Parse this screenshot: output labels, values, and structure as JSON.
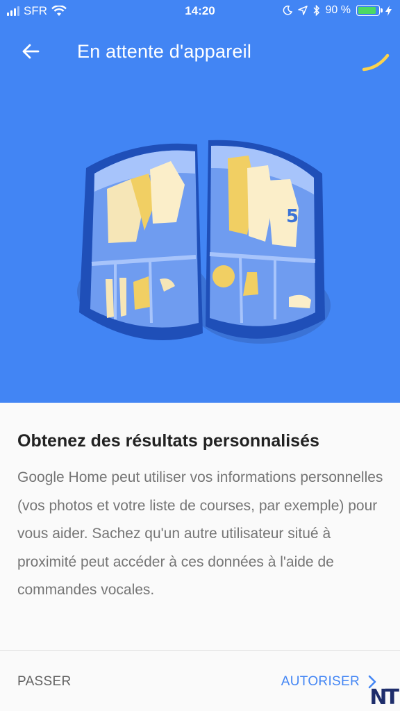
{
  "status_bar": {
    "carrier": "SFR",
    "time": "14:20",
    "battery": "90 %",
    "battery_level": 0.9
  },
  "app_bar": {
    "title": "En attente d'appareil"
  },
  "content": {
    "heading": "Obtenez des résultats personnalisés",
    "body": "Google Home peut utiliser vos informations personnelles (vos photos et votre liste de courses, par exemple) pour vous aider. Sachez qu'un autre utilisateur situé à proximité peut accéder à ces données à l'aide de commandes vocales."
  },
  "actions": {
    "skip_label": "PASSER",
    "allow_label": "AUTORISER"
  },
  "watermark": "NT",
  "colors": {
    "primary": "#4285f4",
    "accent_yellow": "#fbd34d"
  }
}
